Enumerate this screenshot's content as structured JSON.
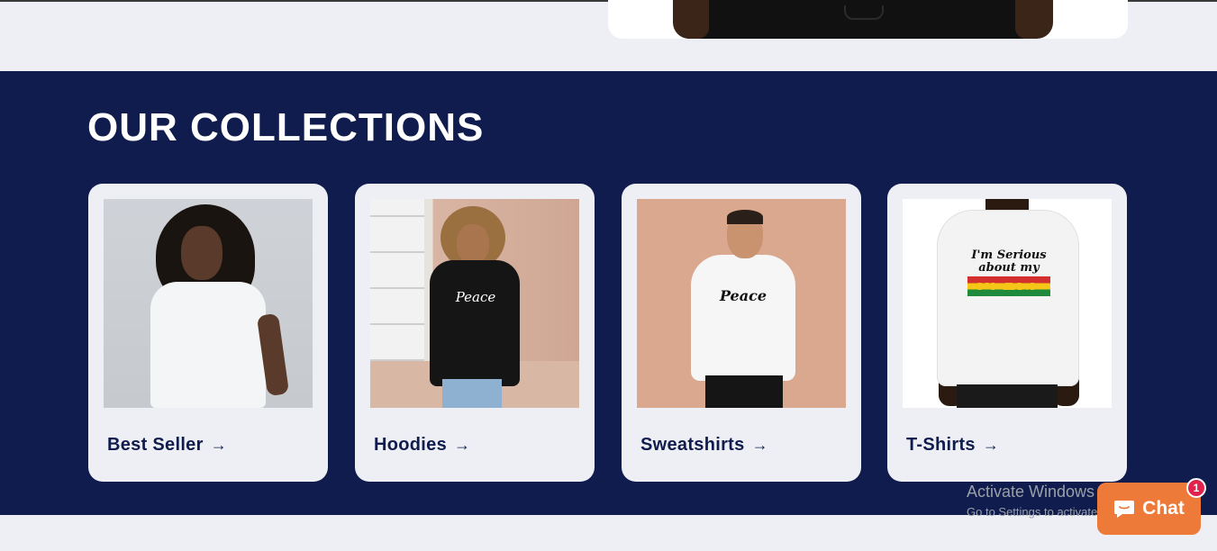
{
  "collections": {
    "title": "OUR COLLECTIONS",
    "items": [
      {
        "label": "Best Seller",
        "arrow": "→"
      },
      {
        "label": "Hoodies",
        "arrow": "→"
      },
      {
        "label": "Sweatshirts",
        "arrow": "→"
      },
      {
        "label": "T-Shirts",
        "arrow": "→"
      }
    ]
  },
  "products": {
    "hoodie_print": "Peace",
    "sweatshirt_print": "Peace",
    "tshirt_print_line1": "I'm Serious",
    "tshirt_print_line2": "about my",
    "tshirt_print_line3": "PEACE"
  },
  "watermark": {
    "line1": "Activate Windows",
    "line2": "Go to Settings to activate Windows."
  },
  "chat": {
    "label": "Chat",
    "badge_count": "1",
    "icon": "chat-bubble-icon"
  },
  "colors": {
    "section_bg": "#0f1c4d",
    "page_bg": "#eeeff4",
    "chat_bg": "#ee7a3a",
    "badge_bg": "#e0224d"
  }
}
